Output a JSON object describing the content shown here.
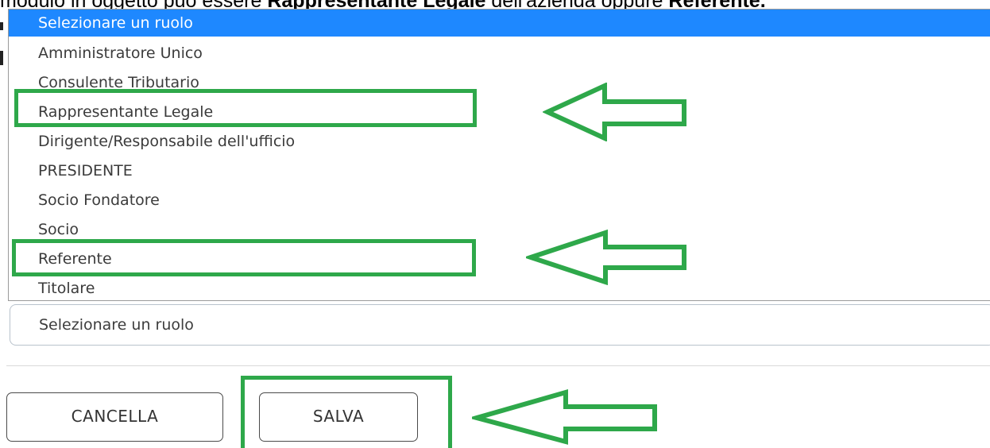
{
  "instruction": {
    "prefix": "modulo in oggetto può essere ",
    "bold1": "Rappresentante Legale",
    "middle": " dell'azienda oppure ",
    "bold2": "Referente."
  },
  "dropdown": {
    "selected_option": "Selezionare un ruolo",
    "options": [
      "Amministratore Unico",
      "Consulente Tributario",
      "Rappresentante Legale",
      "Dirigente/Responsabile dell'ufficio",
      "PRESIDENTE",
      "Socio Fondatore",
      "Socio",
      "Referente",
      "Titolare"
    ]
  },
  "select_field": {
    "value": "Selezionare un ruolo"
  },
  "buttons": {
    "cancel_label": "CANCELLA",
    "save_label": "SALVA"
  },
  "colors": {
    "highlight": "#2ea84a",
    "selected_bg": "#1e88ff"
  },
  "icons": {
    "annotation_arrow": "arrow-left-icon"
  }
}
